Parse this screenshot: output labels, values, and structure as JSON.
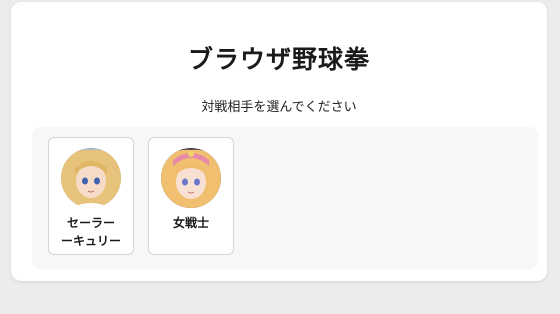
{
  "page": {
    "title": "ブラウザ野球拳",
    "subtitle": "対戦相手を選んでください"
  },
  "opponents": [
    {
      "name_line1": "セーラー",
      "name_line2": "ーキュリー",
      "avatar": "anime-girl-blonde-avatar"
    },
    {
      "name_line1": "女戦士",
      "avatar": "anime-girl-pink-hair-avatar"
    }
  ],
  "colors": {
    "background": "#ececee",
    "card": "#ffffff",
    "panel": "#f7f7f8",
    "border": "#d4d4d8"
  }
}
